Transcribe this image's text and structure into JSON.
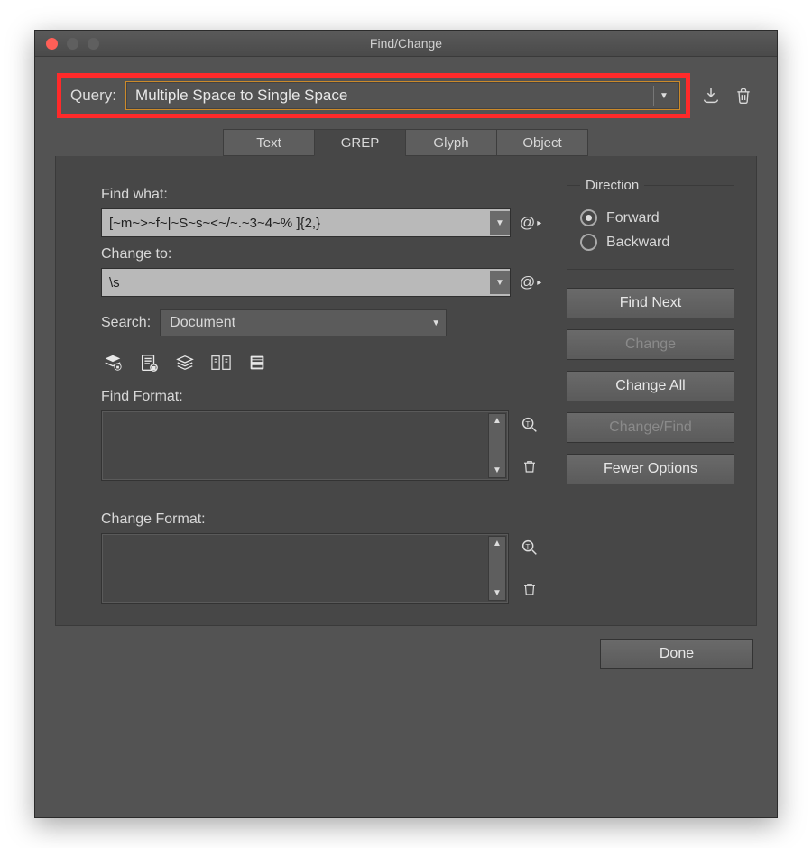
{
  "window": {
    "title": "Find/Change"
  },
  "query": {
    "label": "Query:",
    "value": "Multiple Space to Single Space"
  },
  "tabs": [
    "Text",
    "GREP",
    "Glyph",
    "Object"
  ],
  "active_tab": "GREP",
  "find": {
    "label": "Find what:",
    "value": "[~m~>~f~|~S~s~<~/~.~3~4~% ]{2,}"
  },
  "change": {
    "label": "Change to:",
    "value": "\\s"
  },
  "search_scope": {
    "label": "Search:",
    "value": "Document"
  },
  "direction": {
    "legend": "Direction",
    "options": [
      "Forward",
      "Backward"
    ],
    "selected": "Forward"
  },
  "buttons": {
    "find_next": "Find Next",
    "change": "Change",
    "change_all": "Change All",
    "change_find": "Change/Find",
    "fewer_options": "Fewer Options",
    "done": "Done"
  },
  "format": {
    "find_label": "Find Format:",
    "change_label": "Change Format:"
  }
}
